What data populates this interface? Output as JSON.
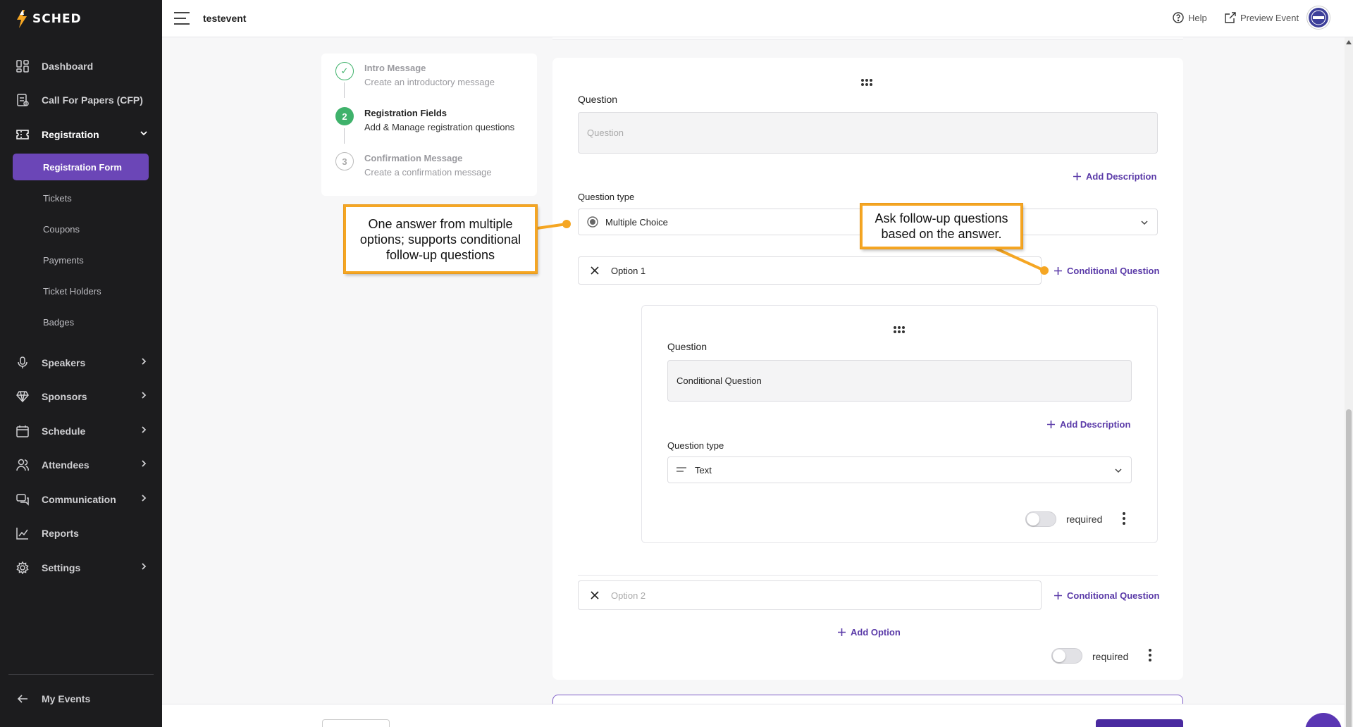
{
  "app": {
    "brand": "SCHED",
    "event_name": "testevent"
  },
  "topbar": {
    "help": "Help",
    "preview": "Preview Event"
  },
  "sidebar": {
    "items": [
      {
        "label": "Dashboard",
        "icon": "dashboard-icon"
      },
      {
        "label": "Call For Papers (CFP)",
        "icon": "document-icon"
      },
      {
        "label": "Registration",
        "icon": "ticket-icon",
        "expanded": true
      },
      {
        "label": "Speakers",
        "icon": "microphone-icon"
      },
      {
        "label": "Sponsors",
        "icon": "diamond-icon"
      },
      {
        "label": "Schedule",
        "icon": "calendar-icon"
      },
      {
        "label": "Attendees",
        "icon": "users-icon"
      },
      {
        "label": "Communication",
        "icon": "chat-icon"
      },
      {
        "label": "Reports",
        "icon": "chart-icon"
      },
      {
        "label": "Settings",
        "icon": "gear-icon"
      }
    ],
    "sub_items": [
      "Registration Form",
      "Tickets",
      "Coupons",
      "Payments",
      "Ticket Holders",
      "Badges"
    ],
    "active_sub": "Registration Form",
    "footer": "My Events"
  },
  "stepper": [
    {
      "num": "✓",
      "title": "Intro Message",
      "sub": "Create an introductory message",
      "state": "done"
    },
    {
      "num": "2",
      "title": "Registration Fields",
      "sub": "Add & Manage registration questions",
      "state": "active"
    },
    {
      "num": "3",
      "title": "Confirmation Message",
      "sub": "Create a confirmation message",
      "state": "pending"
    }
  ],
  "question": {
    "label": "Question",
    "placeholder": "Question",
    "add_description": "Add Description",
    "type_label": "Question type",
    "type_value": "Multiple Choice",
    "options": [
      {
        "value": "Option 1",
        "conditional": "Conditional Question"
      },
      {
        "placeholder": "Option 2",
        "conditional": "Conditional Question"
      }
    ],
    "add_option": "Add Option",
    "required": "required"
  },
  "conditional": {
    "label": "Question",
    "value": "Conditional Question",
    "add_description": "Add Description",
    "type_label": "Question type",
    "type_value": "Text",
    "required": "required"
  },
  "callouts": {
    "multiple_choice": "One answer from multiple options; supports conditional follow-up questions",
    "conditional": "Ask follow-up questions based on the answer."
  },
  "colors": {
    "accent": "#5a3aa8",
    "sidebar_bg": "#1c1c1e",
    "active_item": "#6b46b7",
    "step_done": "#3fb26b",
    "callout_border": "#f5a623"
  }
}
